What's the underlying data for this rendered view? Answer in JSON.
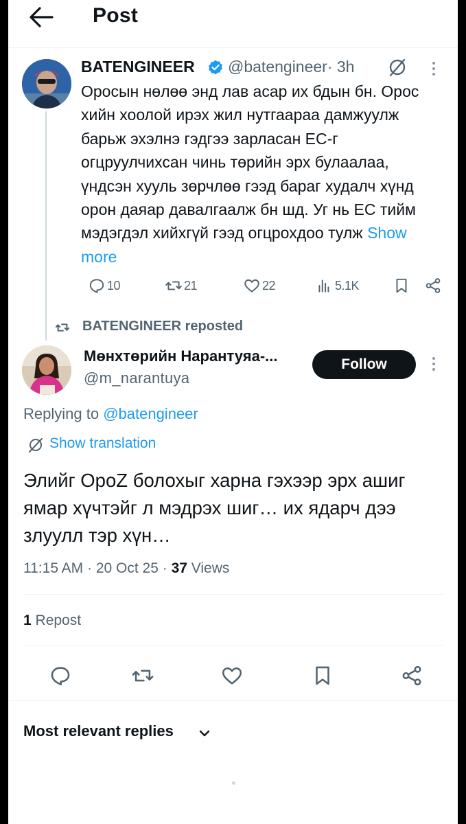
{
  "header": {
    "title": "Post",
    "back_icon": "arrow-left-icon"
  },
  "parent_tweet": {
    "display_name": "BATENGINEER",
    "handle": "@batengineer",
    "time": "· 3h",
    "body": "Оросын нөлөө энд лав асар их бдын бн. Орос хийн хоолой ирэх жил нутгаараа дамжуулж барьж эхэлнэ гэдгээ зарласан ЕС-г огцруулчихсан чинь төрийн эрх булаалаа, үндсэн хууль зөрчлөө гээд бараг худалч хүнд орон даяар давалгаалж бн шд. Уг нь ЕС тийм мэдэгдэл хийхгүй гээд огцрохдоо тулж ",
    "show_more": "Show more",
    "stats": {
      "replies": "10",
      "reposts": "21",
      "likes": "22",
      "views": "5.1K"
    }
  },
  "repost_banner": {
    "text": "BATENGINEER reposted"
  },
  "main_tweet": {
    "display_name": "Мөнхтөрийн Нарантуяа-...",
    "handle": "@m_narantuya",
    "follow_label": "Follow",
    "replying_prefix": "Replying to ",
    "replying_to": "@batengineer",
    "show_translation": "Show translation",
    "body": "Элийг OpoZ болохыг харна гэхээр эрх ашиг ямар хүчтэйг л мэдрэх шиг… их ядарч дээ злуулл тэр хүн…",
    "time": "11:15 AM · 20 Oct 25 · ",
    "views_count": "37",
    "views_label": " Views",
    "repost_count": "1",
    "repost_label": " Repost"
  },
  "sort": {
    "label": "Most relevant replies"
  },
  "colors": {
    "accent": "#1d9bf0",
    "text": "#0f1419",
    "muted": "#536471",
    "divider": "#eff3f4"
  }
}
